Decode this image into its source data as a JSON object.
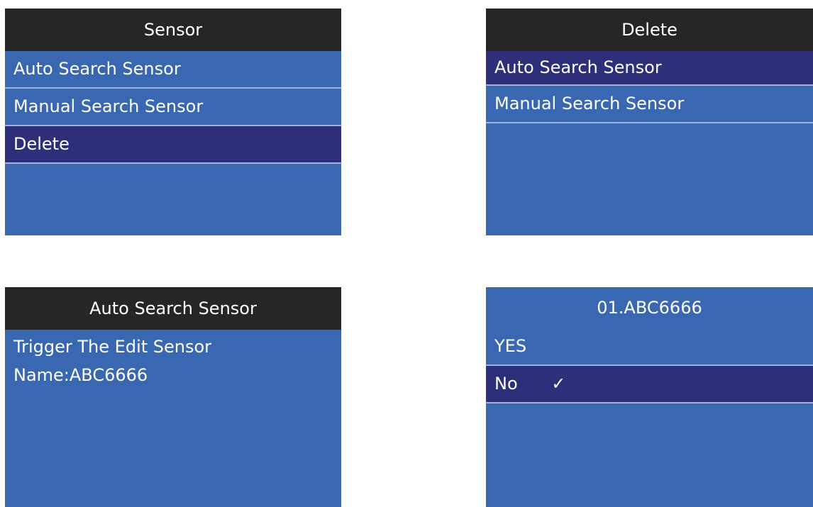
{
  "screens": [
    {
      "title": "Sensor",
      "items": [
        {
          "label": "Auto Search Sensor",
          "selected": false
        },
        {
          "label": "Manual Search Sensor",
          "selected": false
        },
        {
          "label": "Delete",
          "selected": true
        }
      ]
    },
    {
      "title": "Delete",
      "items": [
        {
          "label": "Auto Search Sensor",
          "selected": true
        },
        {
          "label": "Manual Search Sensor",
          "selected": false
        }
      ]
    },
    {
      "title": "Auto Search Sensor",
      "lines": [
        "Trigger The Edit Sensor",
        "Name:ABC6666"
      ]
    },
    {
      "title": "01.ABC6666",
      "items": [
        {
          "label": "YES",
          "selected": false
        },
        {
          "label": "No",
          "selected": true,
          "mark": "✓"
        }
      ]
    }
  ],
  "colors": {
    "screen_background": "#3a67b2",
    "title_bar": "#262626",
    "selected_row": "#2e2f7a",
    "row_divider": "#9db6de",
    "text": "#ffffff"
  },
  "icons": {
    "checkmark": "check-icon"
  }
}
